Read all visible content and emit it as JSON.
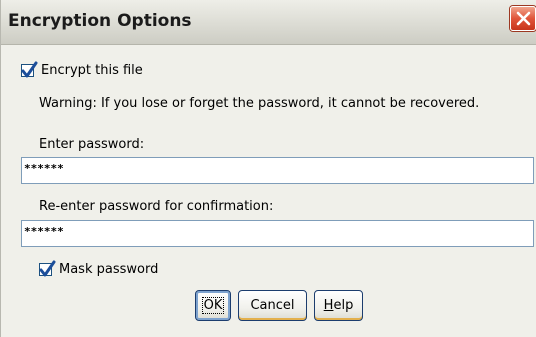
{
  "dialog": {
    "title": "Encryption Options"
  },
  "encrypt_checkbox": {
    "label": "Encrypt this file",
    "checked": true
  },
  "warning": "Warning: If you lose or forget the password, it cannot be recovered.",
  "password": {
    "label": "Enter password:",
    "value": "******"
  },
  "confirm": {
    "label": "Re-enter password for confirmation:",
    "value": "******"
  },
  "mask_checkbox": {
    "label": "Mask password",
    "checked": true
  },
  "buttons": {
    "ok": "OK",
    "cancel": "Cancel",
    "help_mnemonic": "H",
    "help_rest": "elp"
  },
  "colors": {
    "close_button": "#d9442a",
    "check": "#1c4e9a"
  },
  "icons": {
    "close": "close-icon",
    "check": "checkmark-icon"
  }
}
